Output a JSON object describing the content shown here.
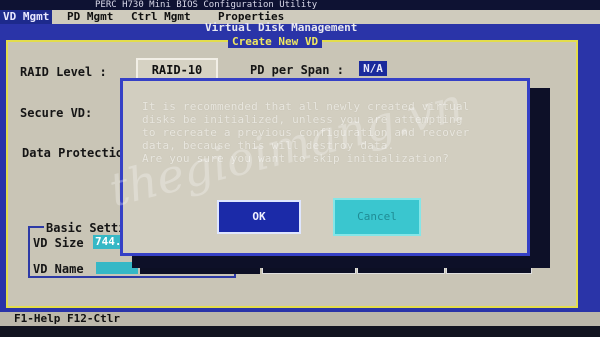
{
  "header": {
    "title": "PERC H730 Mini BIOS Configuration Utility"
  },
  "menu": {
    "items": [
      "VD Mgmt",
      "PD Mgmt",
      "Ctrl Mgmt",
      "Properties"
    ],
    "active": "VD Mgmt"
  },
  "window": {
    "title": "Virtual Disk Management",
    "panel_title": "Create New VD"
  },
  "form": {
    "raid_level_label": "RAID Level  :",
    "raid_level_value": "RAID-10",
    "pd_per_span_label": "PD per Span :",
    "pd_per_span_value": "N/A",
    "secure_vd_label": "Secure VD:",
    "data_protection_label": "Data Protectio",
    "basic_settings_label": "Basic Setti",
    "vd_size_label": "VD Size",
    "vd_size_value": "744.",
    "vd_name_label": "VD Name"
  },
  "dialog": {
    "lines": [
      "It is recommended that all newly created virtual",
      "disks be initialized, unless you are attempting",
      "to recreate a previous configuration and recover",
      "data, because this will destroy data.",
      "Are you sure you want to skip initialization?"
    ],
    "ok_label": "OK",
    "cancel_label": "Cancel"
  },
  "footer": {
    "help_text": "F1-Help F12-Ctlr"
  },
  "watermark": {
    "text": "thegioimang.vn"
  },
  "colors": {
    "menu_bg": "#cfcbbd",
    "window_blue": "#2a34a8",
    "panel_gray": "#c9c5b6",
    "panel_border_yellow": "#e3dd4c",
    "field_cyan": "#36b8c6",
    "ok_blue": "#1b2aa8",
    "cancel_cyan": "#3ac6cf"
  }
}
